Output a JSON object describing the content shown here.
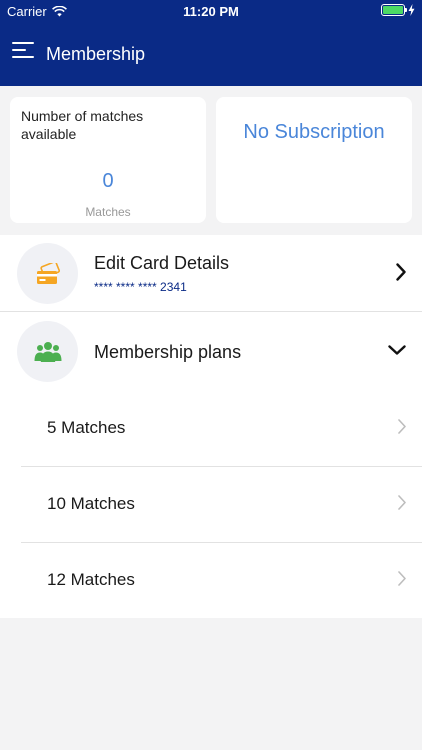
{
  "status_bar": {
    "carrier": "Carrier",
    "time": "11:20 PM"
  },
  "header": {
    "title": "Membership"
  },
  "matches_card": {
    "label": "Number of matches available",
    "value": "0",
    "unit": "Matches"
  },
  "subscription_card": {
    "status": "No Subscription"
  },
  "card_details": {
    "title": "Edit Card Details",
    "card_number": "**** **** **** 2341",
    "icon": "credit-card-icon"
  },
  "membership_plans": {
    "title": "Membership plans",
    "icon": "users-group-icon",
    "plans": [
      {
        "label": "5 Matches"
      },
      {
        "label": "10 Matches"
      },
      {
        "label": "12 Matches"
      }
    ]
  },
  "colors": {
    "nav_bg": "#0a2a86",
    "accent": "#4a86d9",
    "card_icon": "#f5a623",
    "plans_icon": "#4caf50"
  }
}
